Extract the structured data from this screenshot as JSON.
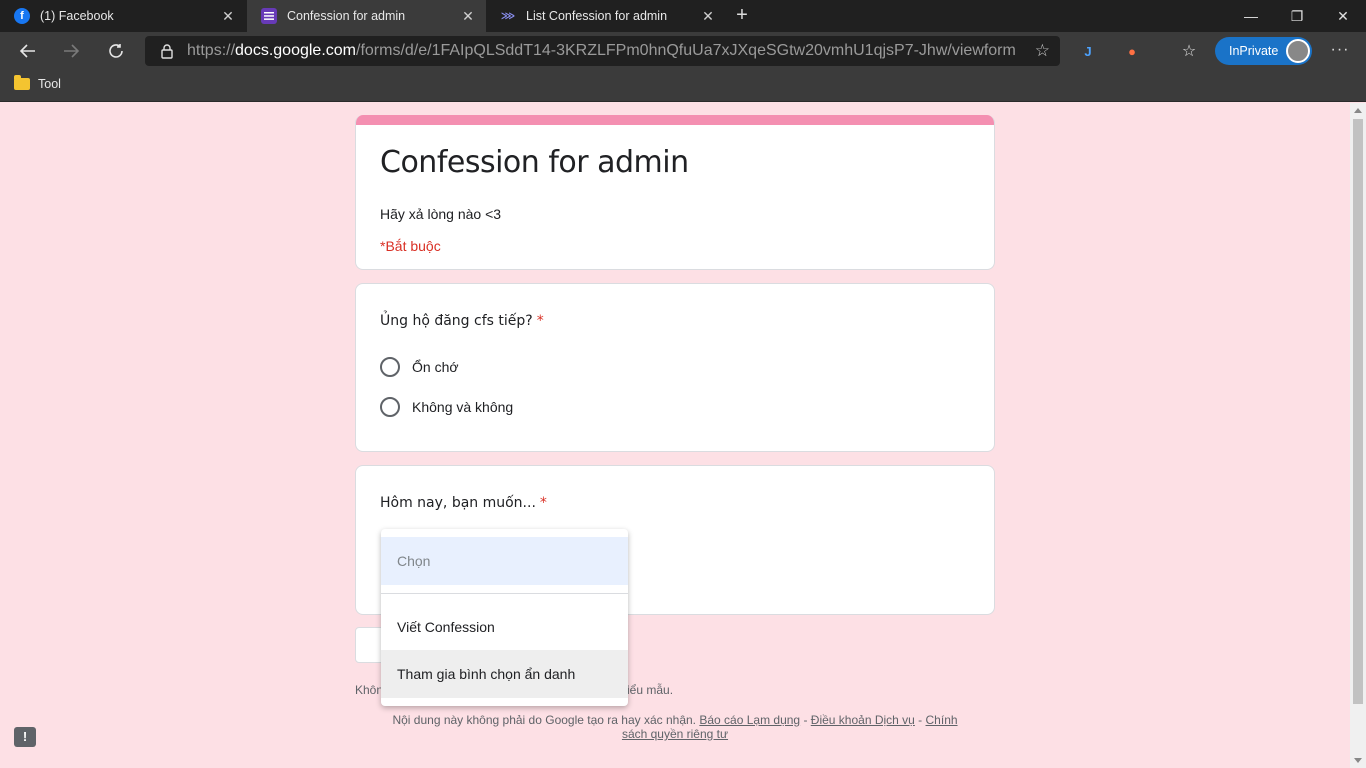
{
  "tabs": [
    {
      "title": "(1) Facebook",
      "favicon": "facebook-icon",
      "active": false
    },
    {
      "title": "Confession for admin",
      "favicon": "google-forms-icon",
      "active": true
    },
    {
      "title": "List Confession for admin",
      "favicon": "sheet-icon",
      "active": false
    }
  ],
  "window_controls": {
    "minimize": "—",
    "restore": "❐",
    "close": "✕"
  },
  "address_bar": {
    "scheme": "https://",
    "host": "docs.google.com",
    "path": "/forms/d/e/1FAIpQLSddT14-3KRZLFPm0hnQfuUa7xJXqeSGtw20vmhU1qjsP7-Jhw/viewform"
  },
  "toolbar": {
    "inprivate_label": "InPrivate"
  },
  "bookmarks": [
    {
      "label": "Tool"
    }
  ],
  "form": {
    "title": "Confession for admin",
    "description": "Hãy xả lòng nào <3",
    "required_note": "*Bắt buộc",
    "questions": [
      {
        "title": "Ủng hộ đăng cfs tiếp?",
        "required": "*",
        "options": [
          "Ổn chớ",
          "Không và không"
        ]
      },
      {
        "title": "Hôm nay, bạn muốn...",
        "required": "*",
        "dropdown": {
          "placeholder": "Chọn",
          "options": [
            "Viết Confession",
            "Tham gia bình chọn ẩn danh"
          ]
        }
      }
    ]
  },
  "footer": {
    "line1_left": "Khôn",
    "line1_right": "iểu mẫu.",
    "disclaimer": "Nội dung này không phải do Google tạo ra hay xác nhận.",
    "report_link": "Báo cáo Lạm dụng",
    "sep1": " - ",
    "terms_link": "Điều khoản Dịch vụ",
    "sep2": " - ",
    "privacy_link": "Chính sách quyền riêng tư"
  },
  "colors": {
    "accent": "#f48fb1",
    "background": "#fde0e5",
    "required": "#d93025",
    "inprivate": "#1a73c8"
  }
}
